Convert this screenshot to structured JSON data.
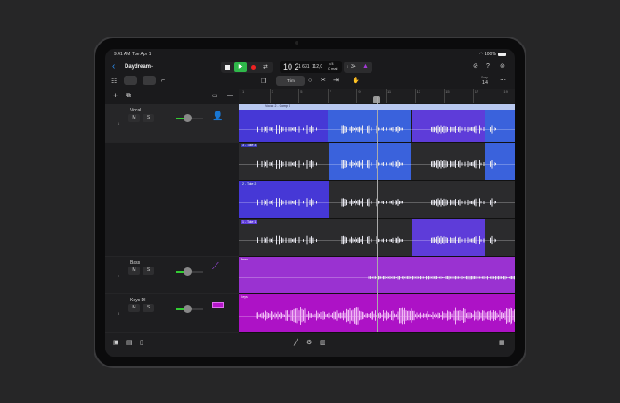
{
  "status": {
    "time": "9:41 AM",
    "date": "Tue Apr 1",
    "battery": "100%"
  },
  "header": {
    "title": "Daydream"
  },
  "lcd": {
    "bars": "10 2",
    "sub": "1 631",
    "tempo": "112,0",
    "signature": "4/4",
    "key": "C maj",
    "count_in": "♩34"
  },
  "toolbar": {
    "trim_label": "Trim",
    "snap_label": "Snap",
    "snap_value": "1/4"
  },
  "ruler": [
    "1",
    "3",
    "5",
    "7",
    "9",
    "11",
    "13",
    "15",
    "17",
    "19"
  ],
  "tracks": [
    {
      "number": "1",
      "name": "Vocal",
      "mute": "M",
      "solo": "S",
      "icon": "singer-icon",
      "color": "#2f8ff0"
    },
    {
      "number": "2",
      "name": "Bass",
      "mute": "M",
      "solo": "S",
      "icon": "bass-guitar-icon",
      "color": "#a24ce8"
    },
    {
      "number": "3",
      "name": "Keys DI",
      "mute": "M",
      "solo": "S",
      "icon": "keyboard-icon",
      "color": "#b516c9"
    }
  ],
  "regions": {
    "comp": "Vocal: 2 - Comp 0",
    "take3": "3 - Take 3",
    "take2": "2 - Take 2",
    "take1": "1 - Take 1",
    "bass": "Bass",
    "keys": "Keys"
  },
  "colors": {
    "indigo": "#4638d6",
    "blue": "#3a62dc",
    "purple": "#5e3cd9",
    "bass": "#9a32d1",
    "keys": "#ad12c6",
    "take_bg": "#2b2b2d"
  }
}
